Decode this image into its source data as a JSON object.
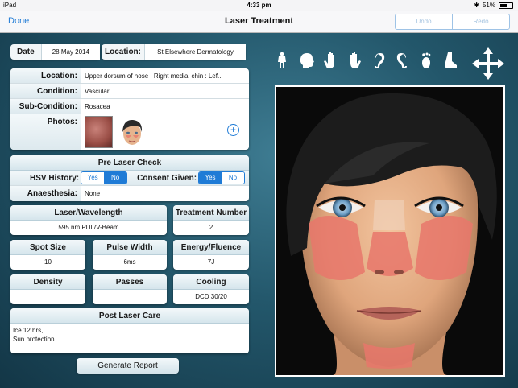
{
  "status": {
    "carrier": "iPad",
    "time": "4:33 pm",
    "battery": "51%"
  },
  "nav": {
    "done": "Done",
    "title": "Laser Treatment",
    "undo": "Undo",
    "redo": "Redo"
  },
  "header": {
    "date_label": "Date",
    "date_value": "28 May 2014",
    "location_label": "Location:",
    "location_value": "St Elsewhere Dermatology"
  },
  "details": {
    "location_label": "Location:",
    "location_value": "Upper dorsum of nose : Right medial chin : Lef...",
    "condition_label": "Condition:",
    "condition_value": "Vascular",
    "subcondition_label": "Sub-Condition:",
    "subcondition_value": "Rosacea",
    "photos_label": "Photos:"
  },
  "prelaser": {
    "title": "Pre Laser Check",
    "hsv_label": "HSV History:",
    "hsv_yes": "Yes",
    "hsv_no": "No",
    "hsv_selected": "No",
    "consent_label": "Consent Given:",
    "consent_yes": "Yes",
    "consent_no": "No",
    "consent_selected": "Yes",
    "anaesthesia_label": "Anaesthesia:",
    "anaesthesia_value": "None"
  },
  "params": {
    "laser_label": "Laser/Wavelength",
    "laser_value": "595 nm PDL/V-Beam",
    "treatment_label": "Treatment Number",
    "treatment_value": "2",
    "spot_label": "Spot Size",
    "spot_value": "10",
    "pulse_label": "Pulse Width",
    "pulse_value": "6ms",
    "energy_label": "Energy/Fluence",
    "energy_value": "7J",
    "density_label": "Density",
    "density_value": "",
    "passes_label": "Passes",
    "passes_value": "",
    "cooling_label": "Cooling",
    "cooling_value": "DCD 30/20"
  },
  "postcare": {
    "title": "Post Laser Care",
    "line1": "Ice 12 hrs,",
    "line2": "Sun protection"
  },
  "report_button": "Generate Report",
  "body_icons": [
    "body-icon",
    "head-icon",
    "hand-front-icon",
    "hand-back-icon",
    "ear-left-icon",
    "ear-right-icon",
    "foot-icon",
    "foot-side-icon"
  ],
  "colors": {
    "accent": "#1f7bd6",
    "treatment_area": "#e8776b"
  }
}
